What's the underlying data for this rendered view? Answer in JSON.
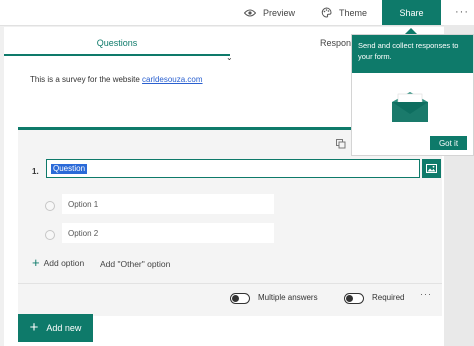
{
  "topbar": {
    "preview_label": "Preview",
    "theme_label": "Theme",
    "share_label": "Share",
    "more_label": "···"
  },
  "tabs": {
    "questions_label": "Questions",
    "responses_label": "Respon"
  },
  "form": {
    "description_text": "This is a survey for the website ",
    "description_link": "carldesouza.com"
  },
  "question": {
    "number": "1.",
    "title": "Question",
    "options": [
      {
        "label": "Option 1"
      },
      {
        "label": "Option 2"
      }
    ],
    "add_option_label": "Add option",
    "add_other_label": "Add \"Other\" option",
    "multiple_answers_label": "Multiple answers",
    "required_label": "Required",
    "more_label": "···"
  },
  "add_new_label": "Add new",
  "share_popup": {
    "message": "Send and collect responses to your form.",
    "got_it_label": "Got it"
  },
  "colors": {
    "accent": "#0e7a6a",
    "selection": "#2b6ad8",
    "link": "#2a60d0"
  },
  "icons": [
    "eye-icon",
    "palette-icon",
    "more-icon",
    "copy-icon",
    "image-icon",
    "plus-icon",
    "envelope-icon"
  ]
}
